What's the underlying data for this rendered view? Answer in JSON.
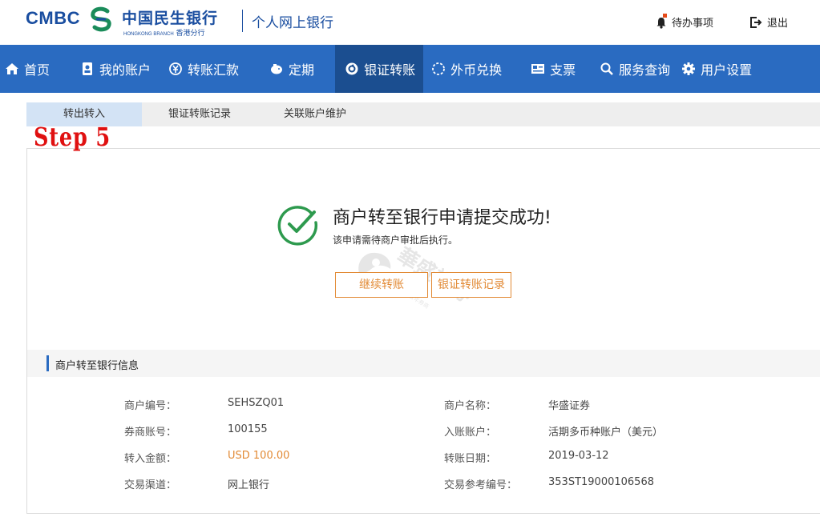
{
  "header": {
    "logo_en": "CMBC",
    "logo_cn": "中国民生银行",
    "logo_branch_en": "HONGKONG BRANCH",
    "logo_branch_cn": "香港分行",
    "subtitle": "个人网上银行",
    "todo_label": "待办事项",
    "logout_label": "退出"
  },
  "nav": {
    "items": [
      {
        "label": "首页",
        "icon": "home-icon"
      },
      {
        "label": "我的账户",
        "icon": "account-book-icon"
      },
      {
        "label": "转账汇款",
        "icon": "transfer-icon"
      },
      {
        "label": "定期",
        "icon": "piggy-bank-icon"
      },
      {
        "label": "银证转账",
        "icon": "securities-transfer-icon"
      },
      {
        "label": "外币兑换",
        "icon": "currency-exchange-icon"
      },
      {
        "label": "支票",
        "icon": "cheque-icon"
      },
      {
        "label": "服务查询",
        "icon": "search-icon"
      },
      {
        "label": "用户设置",
        "icon": "gear-icon"
      }
    ],
    "active_index": 4
  },
  "subtabs": [
    "转出转入",
    "银证转账记录",
    "关联账户维护"
  ],
  "step_label": "Step 5",
  "result": {
    "title": "商户转至银行申请提交成功!",
    "note": "该申请需待商户审批后执行。",
    "continue_button": "继续转账",
    "records_button": "银证转账记录"
  },
  "watermark": {
    "text": "華盛証券",
    "small": "香港十五年券商"
  },
  "info": {
    "section_title": "商户转至银行信息",
    "rows": [
      {
        "label_left": "商户编号：",
        "value_left": "SEHSZQ01",
        "label_right": "商户名称：",
        "value_right": "华盛证券"
      },
      {
        "label_left": "券商账号：",
        "value_left": "100155",
        "label_right": "入账账户：",
        "value_right": "活期多币种账户（美元）"
      },
      {
        "label_left": "转入金额：",
        "value_left": "USD 100.00",
        "label_right": "转账日期：",
        "value_right": "2019-03-12"
      },
      {
        "label_left": "交易渠道：",
        "value_left": "网上银行",
        "label_right": "交易参考编号：",
        "value_right": "353ST19000106568"
      }
    ]
  },
  "colors": {
    "brand_blue": "#1a4ea0",
    "nav_blue": "#2a6bc1",
    "nav_active": "#1b4e90",
    "success_green": "#2e9a4e",
    "accent_orange": "#e28a35"
  }
}
